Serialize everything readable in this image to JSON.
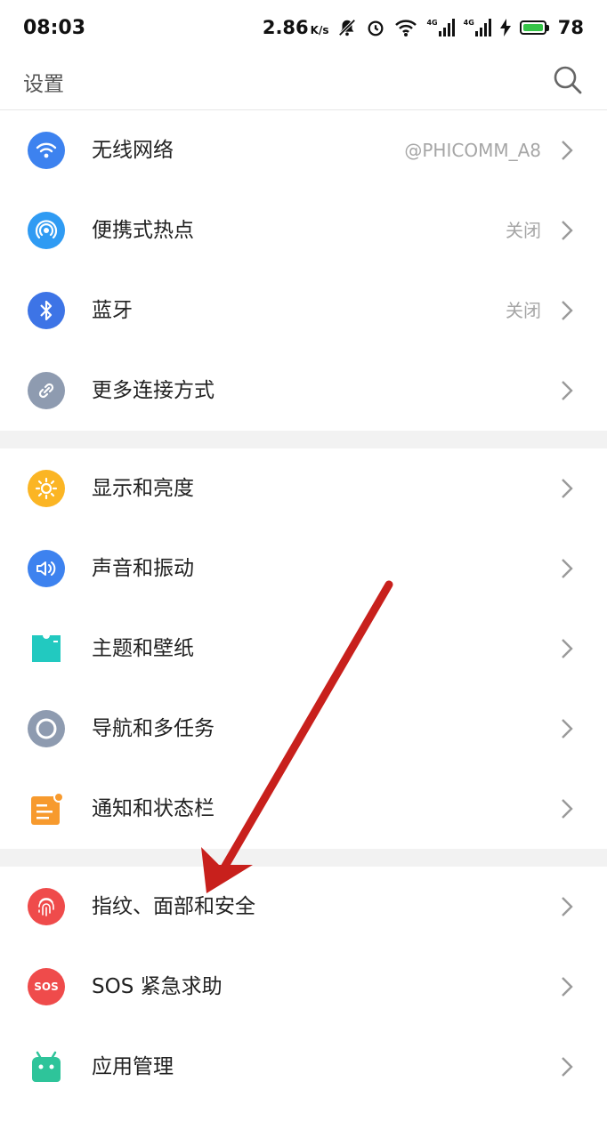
{
  "status_bar": {
    "time": "08:03",
    "speed": "2.86",
    "speed_unit": "K/s",
    "net_tag_1": "4G",
    "net_tag_2": "4G",
    "battery_level": "78"
  },
  "header": {
    "title": "设置"
  },
  "settings": {
    "wifi": {
      "label": "无线网络",
      "value": "@PHICOMM_A8"
    },
    "hotspot": {
      "label": "便携式热点",
      "value": "关闭"
    },
    "bluetooth": {
      "label": "蓝牙",
      "value": "关闭"
    },
    "more_connections": {
      "label": "更多连接方式"
    },
    "display": {
      "label": "显示和亮度"
    },
    "sound": {
      "label": "声音和振动"
    },
    "theme": {
      "label": "主题和壁纸"
    },
    "navigation": {
      "label": "导航和多任务"
    },
    "notifications": {
      "label": "通知和状态栏"
    },
    "security": {
      "label": "指纹、面部和安全"
    },
    "sos": {
      "label": "SOS 紧急求助",
      "icon_text": "SOS"
    },
    "apps": {
      "label": "应用管理"
    }
  },
  "colors": {
    "blue_icon": "#3d82ef",
    "hotspot_icon": "#2f9bf3",
    "gray_icon": "#8e9bb0",
    "yellow_icon": "#fbb524",
    "teal_icon": "#22c9c0",
    "orange_icon": "#f79a2e",
    "red_icon": "#ef4b4b",
    "green_icon": "#2ec49a",
    "annotation_arrow": "#c8201c"
  },
  "icons": [
    "wifi-icon",
    "hotspot-icon",
    "bluetooth-icon",
    "link-icon",
    "sun-icon",
    "speaker-icon",
    "shirt-icon",
    "navigation-icon",
    "notification-icon",
    "fingerprint-icon",
    "sos-icon",
    "android-icon"
  ]
}
